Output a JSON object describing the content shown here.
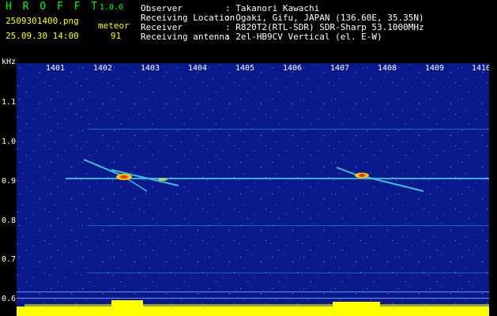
{
  "app": {
    "name": "H R O F F T",
    "version": "1.0.0"
  },
  "file": {
    "name": "2509301400.png",
    "timestamp": "25.09.30 14:00"
  },
  "meteor": {
    "label": "meteor",
    "count": "91"
  },
  "info": [
    {
      "key": "Observer",
      "value": ": Takanori Kawachi"
    },
    {
      "key": "Receiving Location",
      "value": ": Ogaki, Gifu, JAPAN (136.60E, 35.35N)"
    },
    {
      "key": "Receiver",
      "value": ": R820T2(RTL-SDR) SDR-Sharp 53.1000MHz"
    },
    {
      "key": "Receiving antenna",
      "value": ": 2el-HB9CV Vertical (el. E-W)"
    }
  ],
  "axis": {
    "y_unit": "kHz",
    "x_ticks": [
      "1401",
      "1402",
      "1403",
      "1404",
      "1405",
      "1406",
      "1407",
      "1408",
      "1409",
      "1410"
    ],
    "y_ticks": [
      "1.1",
      "1.0",
      "0.9",
      "0.8",
      "0.7",
      "0.6"
    ]
  },
  "colors": {
    "background": "#000000",
    "spectrum_bg": "#0a1a8c",
    "label_yellow": "#ffff00",
    "label_green": "#00ff00"
  }
}
